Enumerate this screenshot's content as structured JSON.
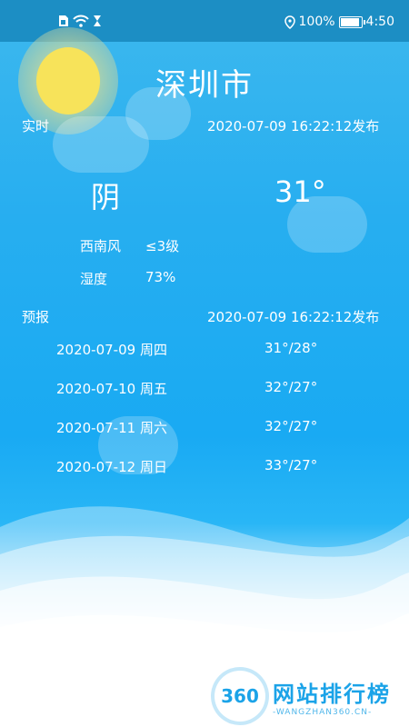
{
  "status_bar": {
    "icons": [
      "sim-icon",
      "wifi-icon",
      "hourglass-icon",
      "location-icon",
      "battery-icon"
    ],
    "battery_text": "100%",
    "time": "4:50"
  },
  "weather": {
    "city": "深圳市",
    "realtime_label": "实时",
    "realtime_published": "2020-07-09 16:22:12发布",
    "condition": "阴",
    "temperature": "31°",
    "wind_label": "西南风",
    "wind_value": "≤3级",
    "humidity_label": "湿度",
    "humidity_value": "73%",
    "forecast_label": "预报",
    "forecast_published": "2020-07-09 16:22:12发布",
    "forecast": [
      {
        "date": "2020-07-09  周四",
        "temp": "31°/28°"
      },
      {
        "date": "2020-07-10  周五",
        "temp": "32°/27°"
      },
      {
        "date": "2020-07-11  周六",
        "temp": "32°/27°"
      },
      {
        "date": "2020-07-12  周日",
        "temp": "33°/27°"
      }
    ]
  },
  "watermark": {
    "badge": "360",
    "name": "网站排行榜",
    "url": "-WANGZHAN360.CN-"
  },
  "colors": {
    "sky_top": "#3db8ee",
    "sky_mid": "#19aaf3",
    "sun": "#f7e35a",
    "brand": "#1ba3e8"
  }
}
